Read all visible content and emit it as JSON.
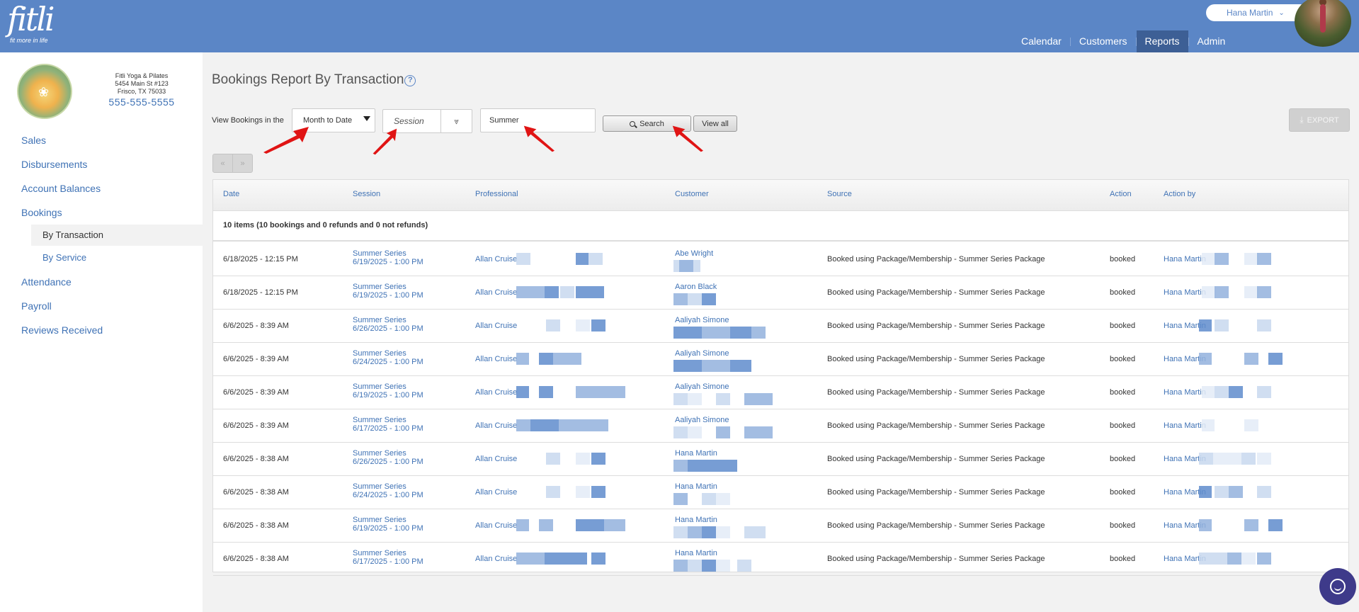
{
  "app": {
    "logo_word": "fitli",
    "logo_tagline": "fit more in life",
    "user_name": "Hana Martin",
    "nav": [
      "Calendar",
      "Customers",
      "Reports",
      "Admin"
    ],
    "nav_active": "Reports"
  },
  "studio": {
    "name": "Fitli Yoga & Pilates",
    "address1": "5454 Main St #123",
    "address2": "Frisco, TX 75033",
    "phone": "555-555-5555"
  },
  "sidebar": {
    "items": [
      "Sales",
      "Disbursements",
      "Account Balances",
      "Bookings",
      "Attendance",
      "Payroll",
      "Reviews Received"
    ],
    "bookings_sub": [
      "By Transaction",
      "By Service"
    ],
    "active_sub": "By Transaction"
  },
  "page": {
    "title": "Bookings Report By Transaction",
    "filter_label": "View Bookings in the",
    "range_value": "Month to Date",
    "session_placeholder": "Session",
    "search_value": "Summer",
    "search_button": "Search",
    "viewall_button": "View all",
    "export_button": "EXPORT",
    "pager_prev": "«",
    "pager_next": "»"
  },
  "table": {
    "columns": [
      "Date",
      "Session",
      "Professional",
      "Customer",
      "Source",
      "Action",
      "Action by"
    ],
    "summary": "10 items (10 bookings and 0 refunds and 0 not refunds)",
    "rows": [
      {
        "date": "6/18/2025 - 12:15 PM",
        "session": "Summer Series",
        "session_time": "6/19/2025 - 1:00 PM",
        "professional": "Allan Cruise",
        "customer": "Abe Wright",
        "source": "Booked using Package/Membership - Summer Series Package",
        "action": "booked",
        "by": "Hana Martin"
      },
      {
        "date": "6/18/2025 - 12:15 PM",
        "session": "Summer Series",
        "session_time": "6/19/2025 - 1:00 PM",
        "professional": "Allan Cruise",
        "customer": "Aaron Black",
        "source": "Booked using Package/Membership - Summer Series Package",
        "action": "booked",
        "by": "Hana Martin"
      },
      {
        "date": "6/6/2025 - 8:39 AM",
        "session": "Summer Series",
        "session_time": "6/26/2025 - 1:00 PM",
        "professional": "Allan Cruise",
        "customer": "Aaliyah Simone",
        "source": "Booked using Package/Membership - Summer Series Package",
        "action": "booked",
        "by": "Hana Martin"
      },
      {
        "date": "6/6/2025 - 8:39 AM",
        "session": "Summer Series",
        "session_time": "6/24/2025 - 1:00 PM",
        "professional": "Allan Cruise",
        "customer": "Aaliyah Simone",
        "source": "Booked using Package/Membership - Summer Series Package",
        "action": "booked",
        "by": "Hana Martin"
      },
      {
        "date": "6/6/2025 - 8:39 AM",
        "session": "Summer Series",
        "session_time": "6/19/2025 - 1:00 PM",
        "professional": "Allan Cruise",
        "customer": "Aaliyah Simone",
        "source": "Booked using Package/Membership - Summer Series Package",
        "action": "booked",
        "by": "Hana Martin"
      },
      {
        "date": "6/6/2025 - 8:39 AM",
        "session": "Summer Series",
        "session_time": "6/17/2025 - 1:00 PM",
        "professional": "Allan Cruise",
        "customer": "Aaliyah Simone",
        "source": "Booked using Package/Membership - Summer Series Package",
        "action": "booked",
        "by": "Hana Martin"
      },
      {
        "date": "6/6/2025 - 8:38 AM",
        "session": "Summer Series",
        "session_time": "6/26/2025 - 1:00 PM",
        "professional": "Allan Cruise",
        "customer": "Hana Martin",
        "source": "Booked using Package/Membership - Summer Series Package",
        "action": "booked",
        "by": "Hana Martin"
      },
      {
        "date": "6/6/2025 - 8:38 AM",
        "session": "Summer Series",
        "session_time": "6/24/2025 - 1:00 PM",
        "professional": "Allan Cruise",
        "customer": "Hana Martin",
        "source": "Booked using Package/Membership - Summer Series Package",
        "action": "booked",
        "by": "Hana Martin"
      },
      {
        "date": "6/6/2025 - 8:38 AM",
        "session": "Summer Series",
        "session_time": "6/19/2025 - 1:00 PM",
        "professional": "Allan Cruise",
        "customer": "Hana Martin",
        "source": "Booked using Package/Membership - Summer Series Package",
        "action": "booked",
        "by": "Hana Martin"
      },
      {
        "date": "6/6/2025 - 8:38 AM",
        "session": "Summer Series",
        "session_time": "6/17/2025 - 1:00 PM",
        "professional": "Allan Cruise",
        "customer": "Hana Martin",
        "source": "Booked using Package/Membership - Summer Series Package",
        "action": "booked",
        "by": "Hana Martin"
      }
    ]
  },
  "colors": {
    "header": "#5b86c6",
    "nav_active": "#3d5f95",
    "link": "#3f72b5",
    "annotation_arrow": "#e01414"
  }
}
